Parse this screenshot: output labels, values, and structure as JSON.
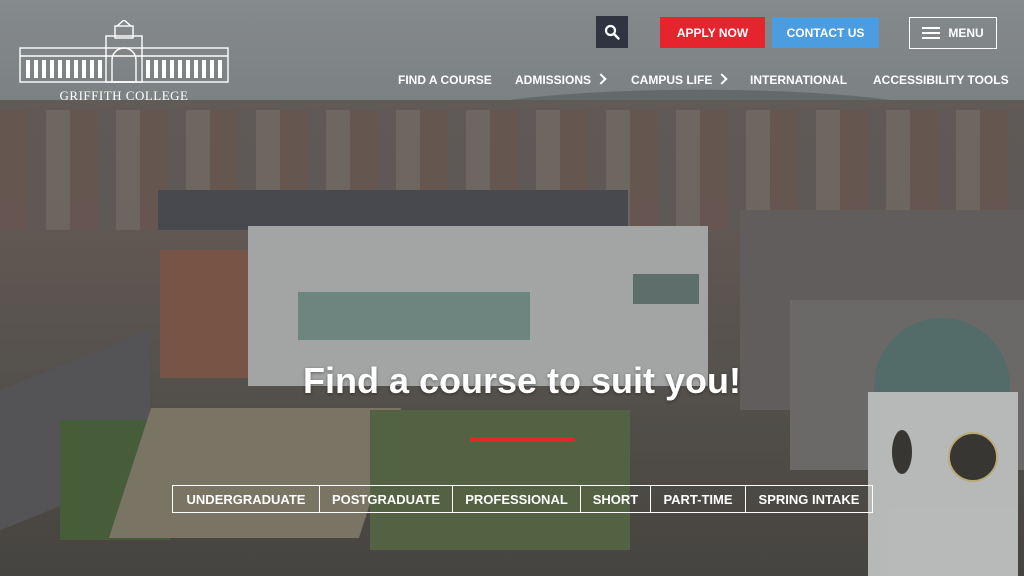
{
  "logo": {
    "text": "GRIFFITH COLLEGE"
  },
  "header": {
    "apply_label": "APPLY NOW",
    "contact_label": "CONTACT US",
    "menu_label": "MENU"
  },
  "nav": {
    "items": [
      {
        "label": "FIND A COURSE",
        "has_submenu": false
      },
      {
        "label": "ADMISSIONS",
        "has_submenu": true
      },
      {
        "label": "CAMPUS LIFE",
        "has_submenu": true
      },
      {
        "label": "INTERNATIONAL",
        "has_submenu": false
      },
      {
        "label": "ACCESSIBILITY TOOLS",
        "has_submenu": false
      }
    ]
  },
  "hero": {
    "title": "Find a course to suit you!"
  },
  "course_tabs": [
    {
      "label": "UNDERGRADUATE"
    },
    {
      "label": "POSTGRADUATE"
    },
    {
      "label": "PROFESSIONAL"
    },
    {
      "label": "SHORT"
    },
    {
      "label": "PART-TIME"
    },
    {
      "label": "SPRING INTAKE"
    }
  ],
  "colors": {
    "apply": "#e5242e",
    "contact": "#4b9de0",
    "search": "#2f3440",
    "accent_rule": "#e5242e"
  },
  "icons": {
    "search": "search-icon",
    "menu": "hamburger-icon",
    "submenu": "chevron-right-icon"
  }
}
